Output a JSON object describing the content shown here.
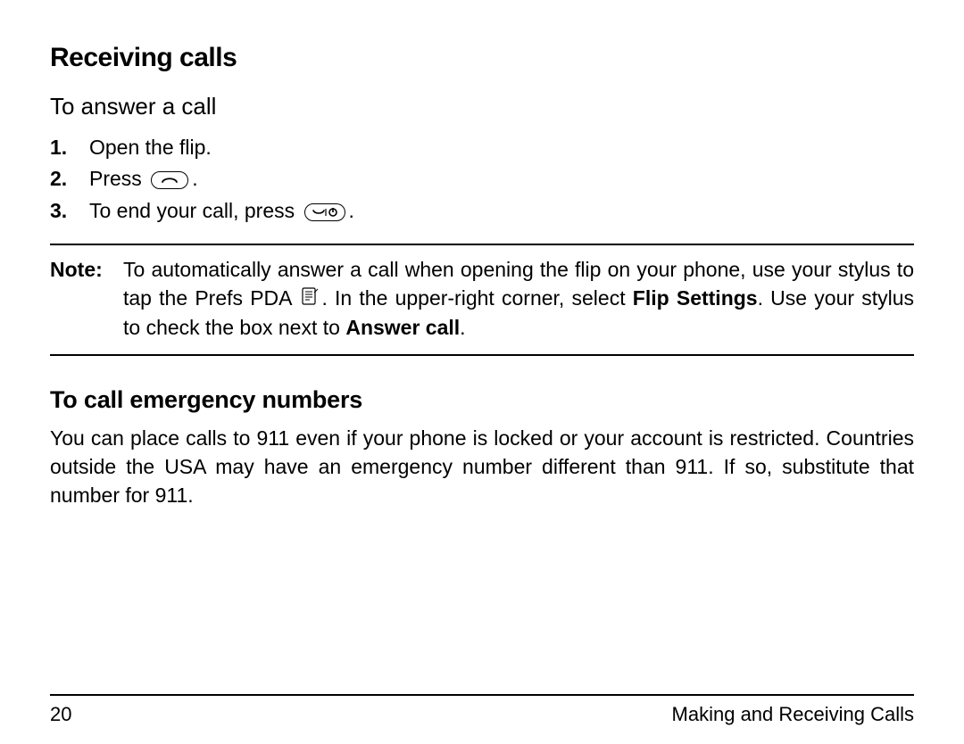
{
  "headings": {
    "receiving": "Receiving calls",
    "to_answer": "To answer a call",
    "emergency": "To call emergency numbers"
  },
  "steps": [
    {
      "num": "1.",
      "text": "Open the flip."
    },
    {
      "num": "2.",
      "text_pre": "Press ",
      "text_post": "."
    },
    {
      "num": "3.",
      "text_pre": "To end your call, press ",
      "text_post": "."
    }
  ],
  "note": {
    "label": "Note:",
    "seg1": "To automatically answer a call when opening the flip on your phone, use your stylus to tap the Prefs PDA ",
    "seg2": ". In the upper-right corner, select ",
    "bold1": "Flip Settings",
    "seg3": ". Use your stylus to check the box next to ",
    "bold2": "Answer call",
    "seg4": "."
  },
  "emergency_body": "You can place calls to 911 even if your phone is locked or your account is restricted. Countries outside the USA may have an emergency number different than 911. If so, substitute that number for 911.",
  "footer": {
    "page": "20",
    "section": "Making and Receiving Calls"
  }
}
